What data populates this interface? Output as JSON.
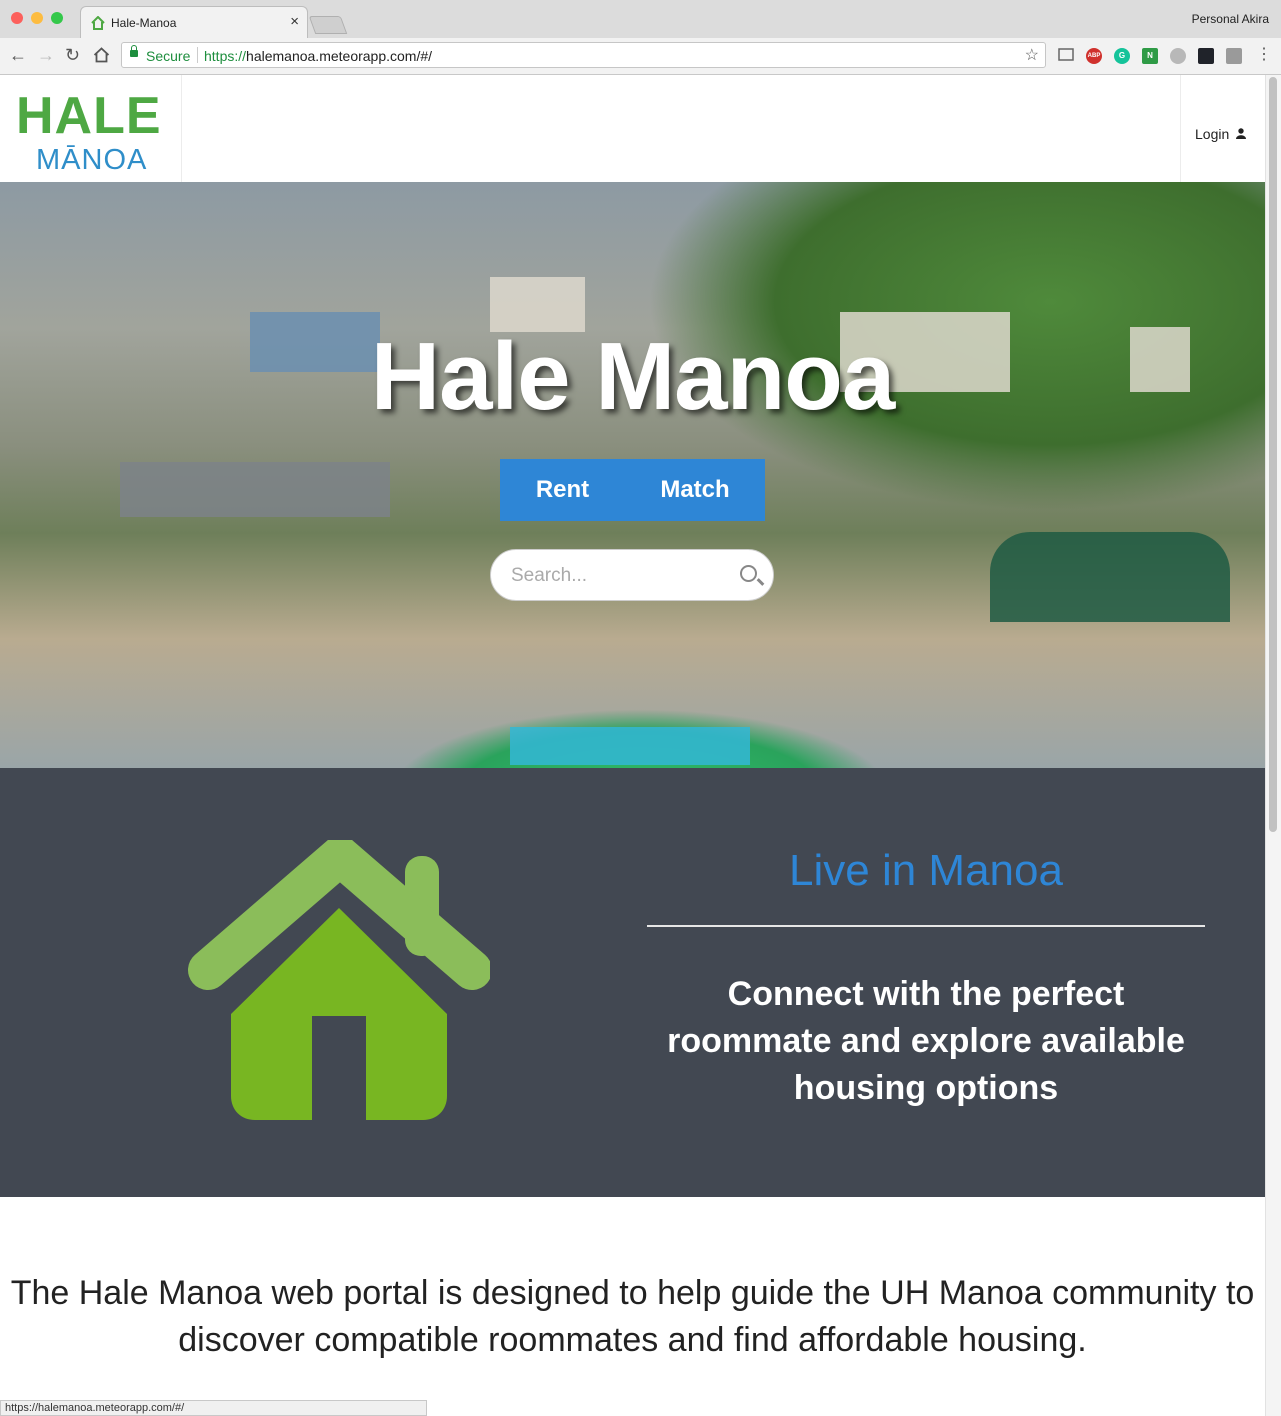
{
  "browser": {
    "tab_title": "Hale-Manoa",
    "tab_close": "×",
    "profile": "Personal Akira",
    "secure_label": "Secure",
    "url_scheme": "https://",
    "url_rest": "halemanoa.meteorapp.com/#/",
    "status_url": "https://halemanoa.meteorapp.com/#/",
    "ext_abp": "ABP",
    "ext_g": "G",
    "ext_n": "N"
  },
  "navbar": {
    "logo_top": "HALE",
    "logo_bottom": "MĀNOA",
    "login": "Login"
  },
  "hero": {
    "title": "Hale Manoa",
    "rent": "Rent",
    "match": "Match",
    "search_placeholder": "Search..."
  },
  "feature": {
    "heading": "Live in Manoa",
    "text": "Connect with the perfect roommate and explore available housing options"
  },
  "about": {
    "text": "The Hale Manoa web portal is designed to help guide the UH Manoa community to discover compatible roommates and find affordable housing."
  },
  "colors": {
    "accent": "#2e86d6",
    "logo_green": "#4ea843",
    "house_green": "#78b622",
    "dark_section": "#424852"
  }
}
